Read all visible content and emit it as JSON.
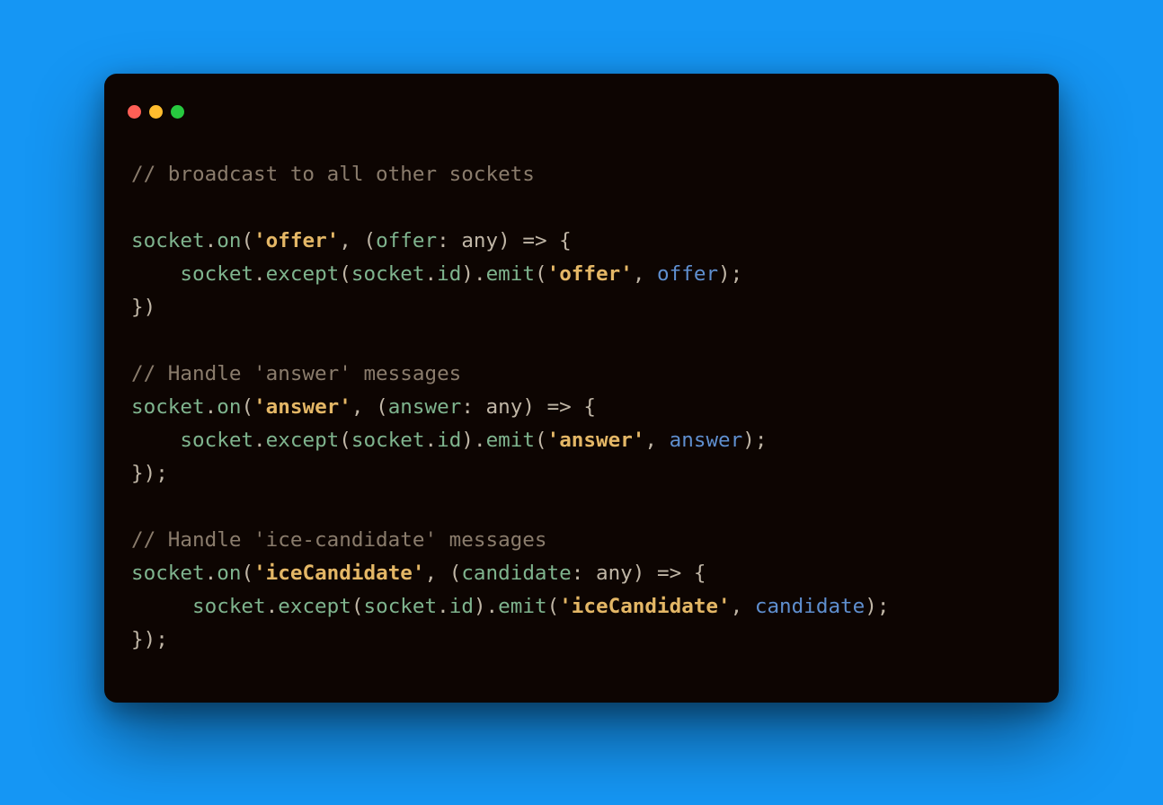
{
  "traffic_lights": [
    "red",
    "yellow",
    "green"
  ],
  "code": {
    "l1": {
      "comment": "// broadcast to all other sockets"
    },
    "l2": "",
    "l3": {
      "socket": "socket",
      "dot1": ".",
      "on": "on",
      "op": "(",
      "sq1": "'offer'",
      "comma": ", (",
      "param": "offer",
      "colon": ": ",
      "type": "any",
      "close": ") ",
      "arrow": "=>",
      "brace": " {"
    },
    "l4": {
      "indent": "    ",
      "socket": "socket",
      "dot1": ".",
      "except": "except",
      "op": "(",
      "socket2": "socket",
      "dot2": ".",
      "id": "id",
      "close1": ").",
      "emit": "emit",
      "op2": "(",
      "sq": "'offer'",
      "comma": ", ",
      "arg": "offer",
      "close2": ");"
    },
    "l5": {
      "close": "})"
    },
    "l6": "",
    "l7": {
      "comment": "// Handle 'answer' messages"
    },
    "l8": {
      "socket": "socket",
      "dot1": ".",
      "on": "on",
      "op": "(",
      "sq1": "'answer'",
      "comma": ", (",
      "param": "answer",
      "colon": ": ",
      "type": "any",
      "close": ") ",
      "arrow": "=>",
      "brace": " {"
    },
    "l9": {
      "indent": "    ",
      "socket": "socket",
      "dot1": ".",
      "except": "except",
      "op": "(",
      "socket2": "socket",
      "dot2": ".",
      "id": "id",
      "close1": ").",
      "emit": "emit",
      "op2": "(",
      "sq": "'answer'",
      "comma": ", ",
      "arg": "answer",
      "close2": ");"
    },
    "l10": {
      "close": "});"
    },
    "l11": "",
    "l12": {
      "comment": "// Handle 'ice-candidate' messages"
    },
    "l13": {
      "socket": "socket",
      "dot1": ".",
      "on": "on",
      "op": "(",
      "sq1": "'iceCandidate'",
      "comma": ", (",
      "param": "candidate",
      "colon": ": ",
      "type": "any",
      "close": ") ",
      "arrow": "=>",
      "brace": " {"
    },
    "l14": {
      "indent": "     ",
      "socket": "socket",
      "dot1": ".",
      "except": "except",
      "op": "(",
      "socket2": "socket",
      "dot2": ".",
      "id": "id",
      "close1": ").",
      "emit": "emit",
      "op2": "(",
      "sq": "'iceCandidate'",
      "comma": ", ",
      "arg": "candidate",
      "close2": ");"
    },
    "l15": {
      "close": "});"
    }
  }
}
